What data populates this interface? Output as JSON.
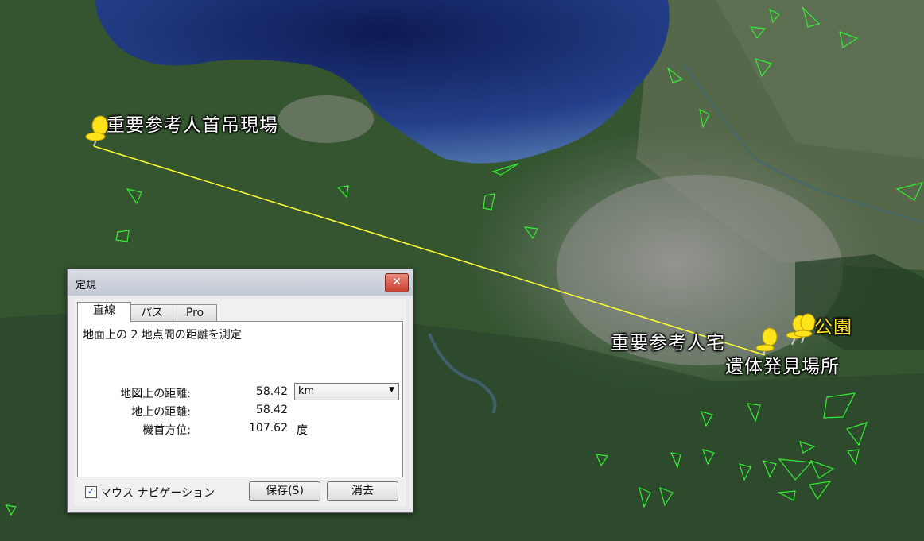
{
  "map": {
    "placemarks": [
      {
        "label": "重要参考人首吊現場"
      },
      {
        "label": "重要参考人宅"
      },
      {
        "label": "遺体発見場所"
      },
      {
        "label": "公園"
      }
    ],
    "colors": {
      "measure_line": "#ffff33",
      "parcel_outline": "#33ee33",
      "pin": "#ffe31a",
      "sea": "#1b2d6e"
    }
  },
  "dialog": {
    "title": "定規",
    "close_glyph": "✕",
    "tabs": [
      {
        "label": "直線",
        "active": true
      },
      {
        "label": "パス",
        "active": false
      },
      {
        "label": "Pro",
        "active": false
      }
    ],
    "description": "地面上の 2 地点間の距離を測定",
    "rows": {
      "map_distance": {
        "label": "地図上の距離:",
        "value": "58.42"
      },
      "ground_distance": {
        "label": "地上の距離:",
        "value": "58.42"
      },
      "heading": {
        "label": "機首方位:",
        "value": "107.62",
        "unit": "度"
      }
    },
    "unit_select": {
      "value": "km"
    },
    "mouse_navigation": {
      "label": "マウス ナビゲーション",
      "checked": true,
      "check_glyph": "✓"
    },
    "buttons": {
      "save": "保存(S)",
      "clear": "消去"
    }
  }
}
